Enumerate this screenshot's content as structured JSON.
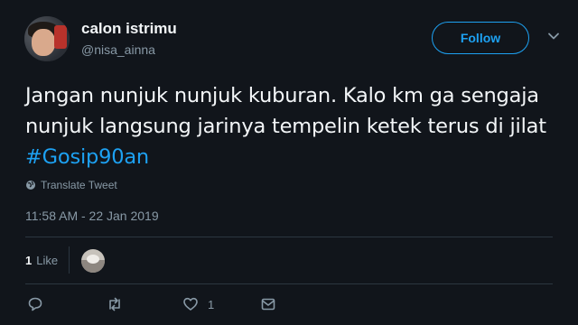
{
  "user": {
    "display_name": "calon istrimu",
    "handle": "@nisa_ainna"
  },
  "follow_button": {
    "label": "Follow"
  },
  "tweet": {
    "text": "Jangan nunjuk nunjuk kuburan. Kalo km ga sengaja nunjuk langsung jarinya tempelin ketek terus di jilat",
    "hashtag": "#Gosip90an",
    "translate_label": "Translate Tweet",
    "timestamp": "11:58 AM - 22 Jan 2019"
  },
  "stats": {
    "likes_count": "1",
    "likes_label": "Like"
  },
  "actions": {
    "reply_icon": "reply-icon",
    "retweet_icon": "retweet-icon",
    "like_icon": "heart-icon",
    "like_count": "1",
    "dm_icon": "mail-icon"
  },
  "colors": {
    "background": "#11151b",
    "accent": "#1da1f2",
    "muted": "#8899a6",
    "text": "#f3f6f8"
  }
}
